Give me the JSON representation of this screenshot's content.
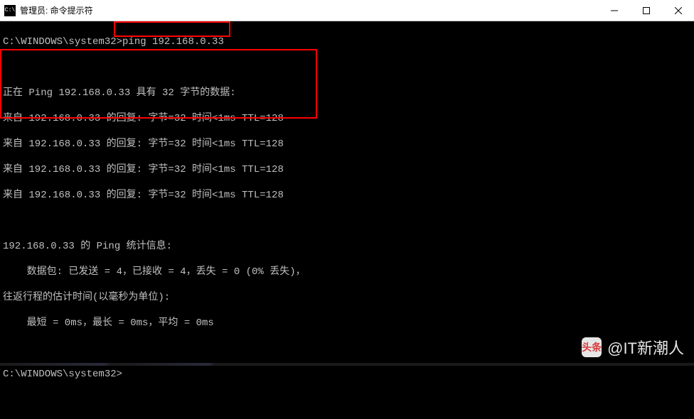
{
  "window": {
    "title": "管理员: 命令提示符"
  },
  "terminal": {
    "prompt1": "C:\\WINDOWS\\system32>",
    "command": "ping 192.168.0.33",
    "blank1": "",
    "ping_header": "正在 Ping 192.168.0.33 具有 32 字节的数据:",
    "reply1": "来自 192.168.0.33 的回复: 字节=32 时间<1ms TTL=128",
    "reply2": "来自 192.168.0.33 的回复: 字节=32 时间<1ms TTL=128",
    "reply3": "来自 192.168.0.33 的回复: 字节=32 时间<1ms TTL=128",
    "reply4": "来自 192.168.0.33 的回复: 字节=32 时间<1ms TTL=128",
    "blank2": "",
    "stats_header": "192.168.0.33 的 Ping 统计信息:",
    "stats_packets": "    数据包: 已发送 = 4，已接收 = 4，丢失 = 0 (0% 丢失)，",
    "rtt_header": "往返行程的估计时间(以毫秒为单位):",
    "rtt_values": "    最短 = 0ms，最长 = 0ms，平均 = 0ms",
    "blank3": "",
    "prompt2": "C:\\WINDOWS\\system32>"
  },
  "watermark": {
    "logo_text": "头条",
    "author": "@IT新潮人"
  }
}
